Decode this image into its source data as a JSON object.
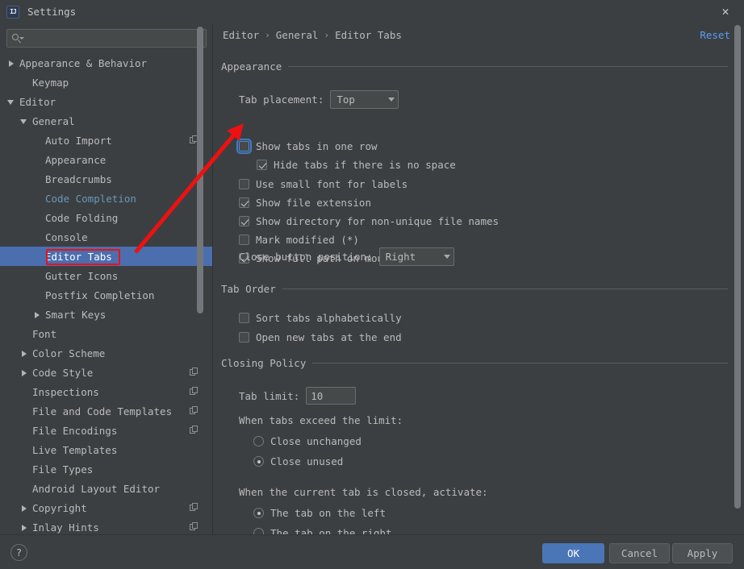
{
  "window": {
    "title": "Settings",
    "app_icon": "intellij-idea-icon",
    "close_icon": "close-icon"
  },
  "sidebar": {
    "search": {
      "value": "",
      "placeholder": "",
      "icon": "search-icon"
    },
    "items": [
      {
        "label": "Appearance & Behavior",
        "indent": 0,
        "arrow": "right",
        "selected": false,
        "link": false,
        "copy": false
      },
      {
        "label": "Keymap",
        "indent": 1,
        "arrow": "none",
        "selected": false,
        "link": false,
        "copy": false
      },
      {
        "label": "Editor",
        "indent": 0,
        "arrow": "down",
        "selected": false,
        "link": false,
        "copy": false
      },
      {
        "label": "General",
        "indent": 1,
        "arrow": "down",
        "selected": false,
        "link": false,
        "copy": false
      },
      {
        "label": "Auto Import",
        "indent": 2,
        "arrow": "none",
        "selected": false,
        "link": false,
        "copy": true
      },
      {
        "label": "Appearance",
        "indent": 2,
        "arrow": "none",
        "selected": false,
        "link": false,
        "copy": false
      },
      {
        "label": "Breadcrumbs",
        "indent": 2,
        "arrow": "none",
        "selected": false,
        "link": false,
        "copy": false
      },
      {
        "label": "Code Completion",
        "indent": 2,
        "arrow": "none",
        "selected": false,
        "link": true,
        "copy": false
      },
      {
        "label": "Code Folding",
        "indent": 2,
        "arrow": "none",
        "selected": false,
        "link": false,
        "copy": false
      },
      {
        "label": "Console",
        "indent": 2,
        "arrow": "none",
        "selected": false,
        "link": false,
        "copy": false
      },
      {
        "label": "Editor Tabs",
        "indent": 2,
        "arrow": "none",
        "selected": true,
        "link": false,
        "copy": false
      },
      {
        "label": "Gutter Icons",
        "indent": 2,
        "arrow": "none",
        "selected": false,
        "link": false,
        "copy": false
      },
      {
        "label": "Postfix Completion",
        "indent": 2,
        "arrow": "none",
        "selected": false,
        "link": false,
        "copy": false
      },
      {
        "label": "Smart Keys",
        "indent": 2,
        "arrow": "right",
        "selected": false,
        "link": false,
        "copy": false
      },
      {
        "label": "Font",
        "indent": 1,
        "arrow": "none",
        "selected": false,
        "link": false,
        "copy": false
      },
      {
        "label": "Color Scheme",
        "indent": 1,
        "arrow": "right",
        "selected": false,
        "link": false,
        "copy": false
      },
      {
        "label": "Code Style",
        "indent": 1,
        "arrow": "right",
        "selected": false,
        "link": false,
        "copy": true
      },
      {
        "label": "Inspections",
        "indent": 1,
        "arrow": "none",
        "selected": false,
        "link": false,
        "copy": true
      },
      {
        "label": "File and Code Templates",
        "indent": 1,
        "arrow": "none",
        "selected": false,
        "link": false,
        "copy": true
      },
      {
        "label": "File Encodings",
        "indent": 1,
        "arrow": "none",
        "selected": false,
        "link": false,
        "copy": true
      },
      {
        "label": "Live Templates",
        "indent": 1,
        "arrow": "none",
        "selected": false,
        "link": false,
        "copy": false
      },
      {
        "label": "File Types",
        "indent": 1,
        "arrow": "none",
        "selected": false,
        "link": false,
        "copy": false
      },
      {
        "label": "Android Layout Editor",
        "indent": 1,
        "arrow": "none",
        "selected": false,
        "link": false,
        "copy": false
      },
      {
        "label": "Copyright",
        "indent": 1,
        "arrow": "right",
        "selected": false,
        "link": false,
        "copy": true
      },
      {
        "label": "Inlay Hints",
        "indent": 1,
        "arrow": "right",
        "selected": false,
        "link": false,
        "copy": true
      }
    ]
  },
  "panel": {
    "breadcrumb": [
      "Editor",
      "General",
      "Editor Tabs"
    ],
    "breadcrumb_separator": "›",
    "reset_label": "Reset",
    "sections": {
      "appearance": {
        "title": "Appearance",
        "tab_placement_label": "Tab placement:",
        "tab_placement_value": "Top",
        "close_button_label": "Close button position:",
        "close_button_value": "Right",
        "checkboxes": [
          {
            "label": "Show tabs in one row",
            "checked": false,
            "focused": true,
            "indent": 0
          },
          {
            "label": "Hide tabs if there is no space",
            "checked": true,
            "focused": false,
            "indent": 1
          },
          {
            "label": "Use small font for labels",
            "checked": false,
            "focused": false,
            "indent": 0
          },
          {
            "label": "Show file extension",
            "checked": true,
            "focused": false,
            "indent": 0
          },
          {
            "label": "Show directory for non-unique file names",
            "checked": true,
            "focused": false,
            "indent": 0
          },
          {
            "label": "Mark modified (*)",
            "checked": false,
            "focused": false,
            "indent": 0
          },
          {
            "label": "Show full path on mouse hover",
            "checked": true,
            "focused": false,
            "indent": 0
          }
        ]
      },
      "tab_order": {
        "title": "Tab Order",
        "checkboxes": [
          {
            "label": "Sort tabs alphabetically",
            "checked": false
          },
          {
            "label": "Open new tabs at the end",
            "checked": false
          }
        ]
      },
      "closing_policy": {
        "title": "Closing Policy",
        "tab_limit_label": "Tab limit:",
        "tab_limit_value": "10",
        "exceed_label": "When tabs exceed the limit:",
        "exceed_options": [
          {
            "label": "Close unchanged",
            "selected": false
          },
          {
            "label": "Close unused",
            "selected": true
          }
        ],
        "activate_label": "When the current tab is closed, activate:",
        "activate_options": [
          {
            "label": "The tab on the left",
            "selected": true
          },
          {
            "label": "The tab on the right",
            "selected": false
          }
        ]
      }
    }
  },
  "footer": {
    "help_label": "?",
    "ok_label": "OK",
    "cancel_label": "Cancel",
    "apply_label": "Apply"
  },
  "annotations": {
    "highlight_target": "Editor Tabs",
    "arrow_color": "#ee1111",
    "rect_color": "#ee1111"
  },
  "colors": {
    "background": "#3c3f41",
    "selection": "#4b6eaf",
    "link": "#6897bb",
    "accent": "#589df6",
    "primary_button": "#4a76b8"
  }
}
